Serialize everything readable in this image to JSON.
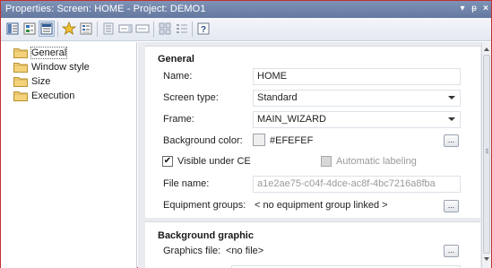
{
  "window": {
    "title": "Properties: Screen: HOME - Project: DEMO1",
    "controls": [
      "pin",
      "dock",
      "close"
    ]
  },
  "toolbar": {
    "buttons": [
      "properties-view-icon",
      "alphabetic-view-icon",
      "categorized-view-icon",
      "favorite-star-icon",
      "list-icon",
      "align-icon",
      "field-icon",
      "field-alt-icon",
      "grid-icon",
      "list-detail-icon",
      "help-icon"
    ]
  },
  "tree": {
    "items": [
      {
        "label": "General",
        "selected": true
      },
      {
        "label": "Window style",
        "selected": false
      },
      {
        "label": "Size",
        "selected": false
      },
      {
        "label": "Execution",
        "selected": false
      }
    ]
  },
  "general": {
    "title": "General",
    "name_label": "Name:",
    "name_value": "HOME",
    "screen_type_label": "Screen type:",
    "screen_type_value": "Standard",
    "frame_label": "Frame:",
    "frame_value": "MAIN_WIZARD",
    "bg_color_label": "Background color:",
    "bg_color_value": "#EFEFEF",
    "bg_color_swatch": "#EFEFEF",
    "visible_ce_label": "Visible under CE",
    "visible_ce_checked": true,
    "auto_labeling_label": "Automatic labeling",
    "auto_labeling_checked": false,
    "file_name_label": "File name:",
    "file_name_value": "a1e2ae75-c04f-4dce-ac8f-4bc7216a8fba",
    "equipment_label": "Equipment groups:",
    "equipment_value": "< no equipment group linked >",
    "ellipsis": "..."
  },
  "background_graphic": {
    "title": "Background graphic",
    "graphics_file_label": "Graphics file:",
    "graphics_file_value": "<no file>"
  },
  "colors": {
    "titlebar": "#6f84ab",
    "pane_bg": "#e9ebef",
    "frame_border": "#c43030"
  }
}
